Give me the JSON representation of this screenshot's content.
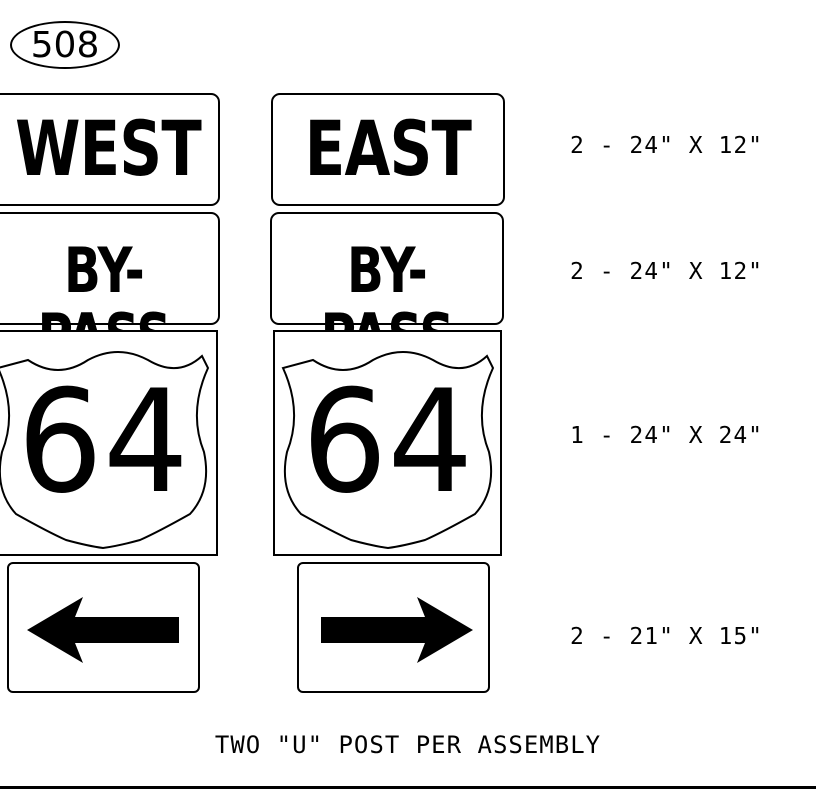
{
  "assembly_number": "508",
  "signs": {
    "west_label": "WEST",
    "east_label": "EAST",
    "bypass_label_left": "BY-PASS",
    "bypass_label_right": "BY-PASS",
    "route_left": "64",
    "route_right": "64"
  },
  "legend": {
    "row1": "2 - 24\" X 12\"",
    "row2": "2 - 24\" X 12\"",
    "row3": "1 - 24\" X 24\"",
    "row4": "2 - 21\" X 15\""
  },
  "note": "TWO \"U\" POST PER ASSEMBLY",
  "icons": [
    "left-arrow-icon",
    "right-arrow-icon",
    "us-route-shield-icon"
  ],
  "colors": {
    "ink": "#000000",
    "background": "#ffffff"
  }
}
